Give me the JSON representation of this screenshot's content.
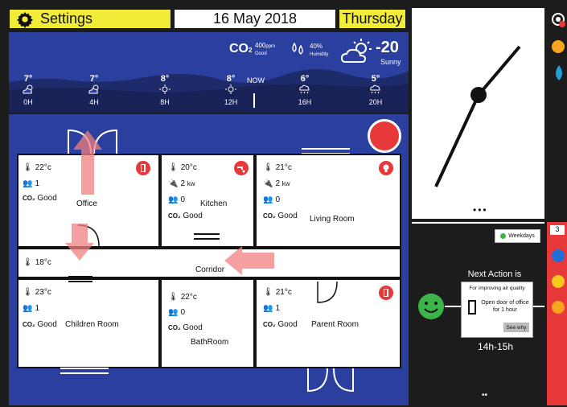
{
  "header": {
    "settings_label": "Settings",
    "date": "16 May 2018",
    "day": "Thursday"
  },
  "weather": {
    "co2_label": "CO",
    "co2_sub": "2",
    "co2_value": "400",
    "co2_unit": "ppm",
    "co2_status": "Good",
    "humidity_value": "40%",
    "humidity_label": "Humidity",
    "temperature": "-20",
    "condition": "Sunny",
    "now_label": "NOW",
    "forecast": [
      {
        "temp": "7°",
        "hour": "0H",
        "icon": "cloud-sun-icon"
      },
      {
        "temp": "7°",
        "hour": "4H",
        "icon": "cloud-sun-icon"
      },
      {
        "temp": "8°",
        "hour": "8H",
        "icon": "sun-icon"
      },
      {
        "temp": "8°",
        "hour": "12H",
        "icon": "sun-icon"
      },
      {
        "temp": "6°",
        "hour": "16H",
        "icon": "rain-cloud-icon"
      },
      {
        "temp": "5°",
        "hour": "20H",
        "icon": "rain-cloud-icon"
      }
    ]
  },
  "rooms": {
    "office": {
      "name": "Office",
      "temp": "22°c",
      "people": "1",
      "co2": "Good",
      "badge_icon": "door-icon"
    },
    "kitchen": {
      "name": "Kitchen",
      "temp": "20°c",
      "power": "2",
      "power_unit": "kw",
      "people": "0",
      "co2": "Good",
      "badge_icon": "faucet-icon"
    },
    "living": {
      "name": "Living Room",
      "temp": "21°c",
      "power": "2",
      "power_unit": "kw",
      "people": "0",
      "co2": "Good",
      "badge_icon": "bulb-icon"
    },
    "corridor": {
      "name": "Corridor",
      "temp": "18°c"
    },
    "children": {
      "name": "Children Room",
      "temp": "23°c",
      "people": "1",
      "co2": "Good"
    },
    "bathroom": {
      "name": "BathRoom",
      "temp": "22°c",
      "people": "0",
      "co2": "Good"
    },
    "parent": {
      "name": "Parent Room",
      "temp": "21°c",
      "people": "1",
      "co2": "Good",
      "badge_icon": "door-icon"
    }
  },
  "co2_prefix": "CO₂",
  "panel": {
    "weekdays_label": "Weekdays",
    "next_action_title": "Next Action is",
    "card_purpose": "For improving air quality",
    "card_action": "Open door of office for 1 hour",
    "see_why_label": "See why",
    "time_range": "14h-15h",
    "side_count": "3"
  },
  "colors": {
    "accent_yellow": "#f1ec38",
    "plan_blue": "#2b3f9f",
    "alert_red": "#e8393a",
    "smile_green": "#3bb54a"
  }
}
